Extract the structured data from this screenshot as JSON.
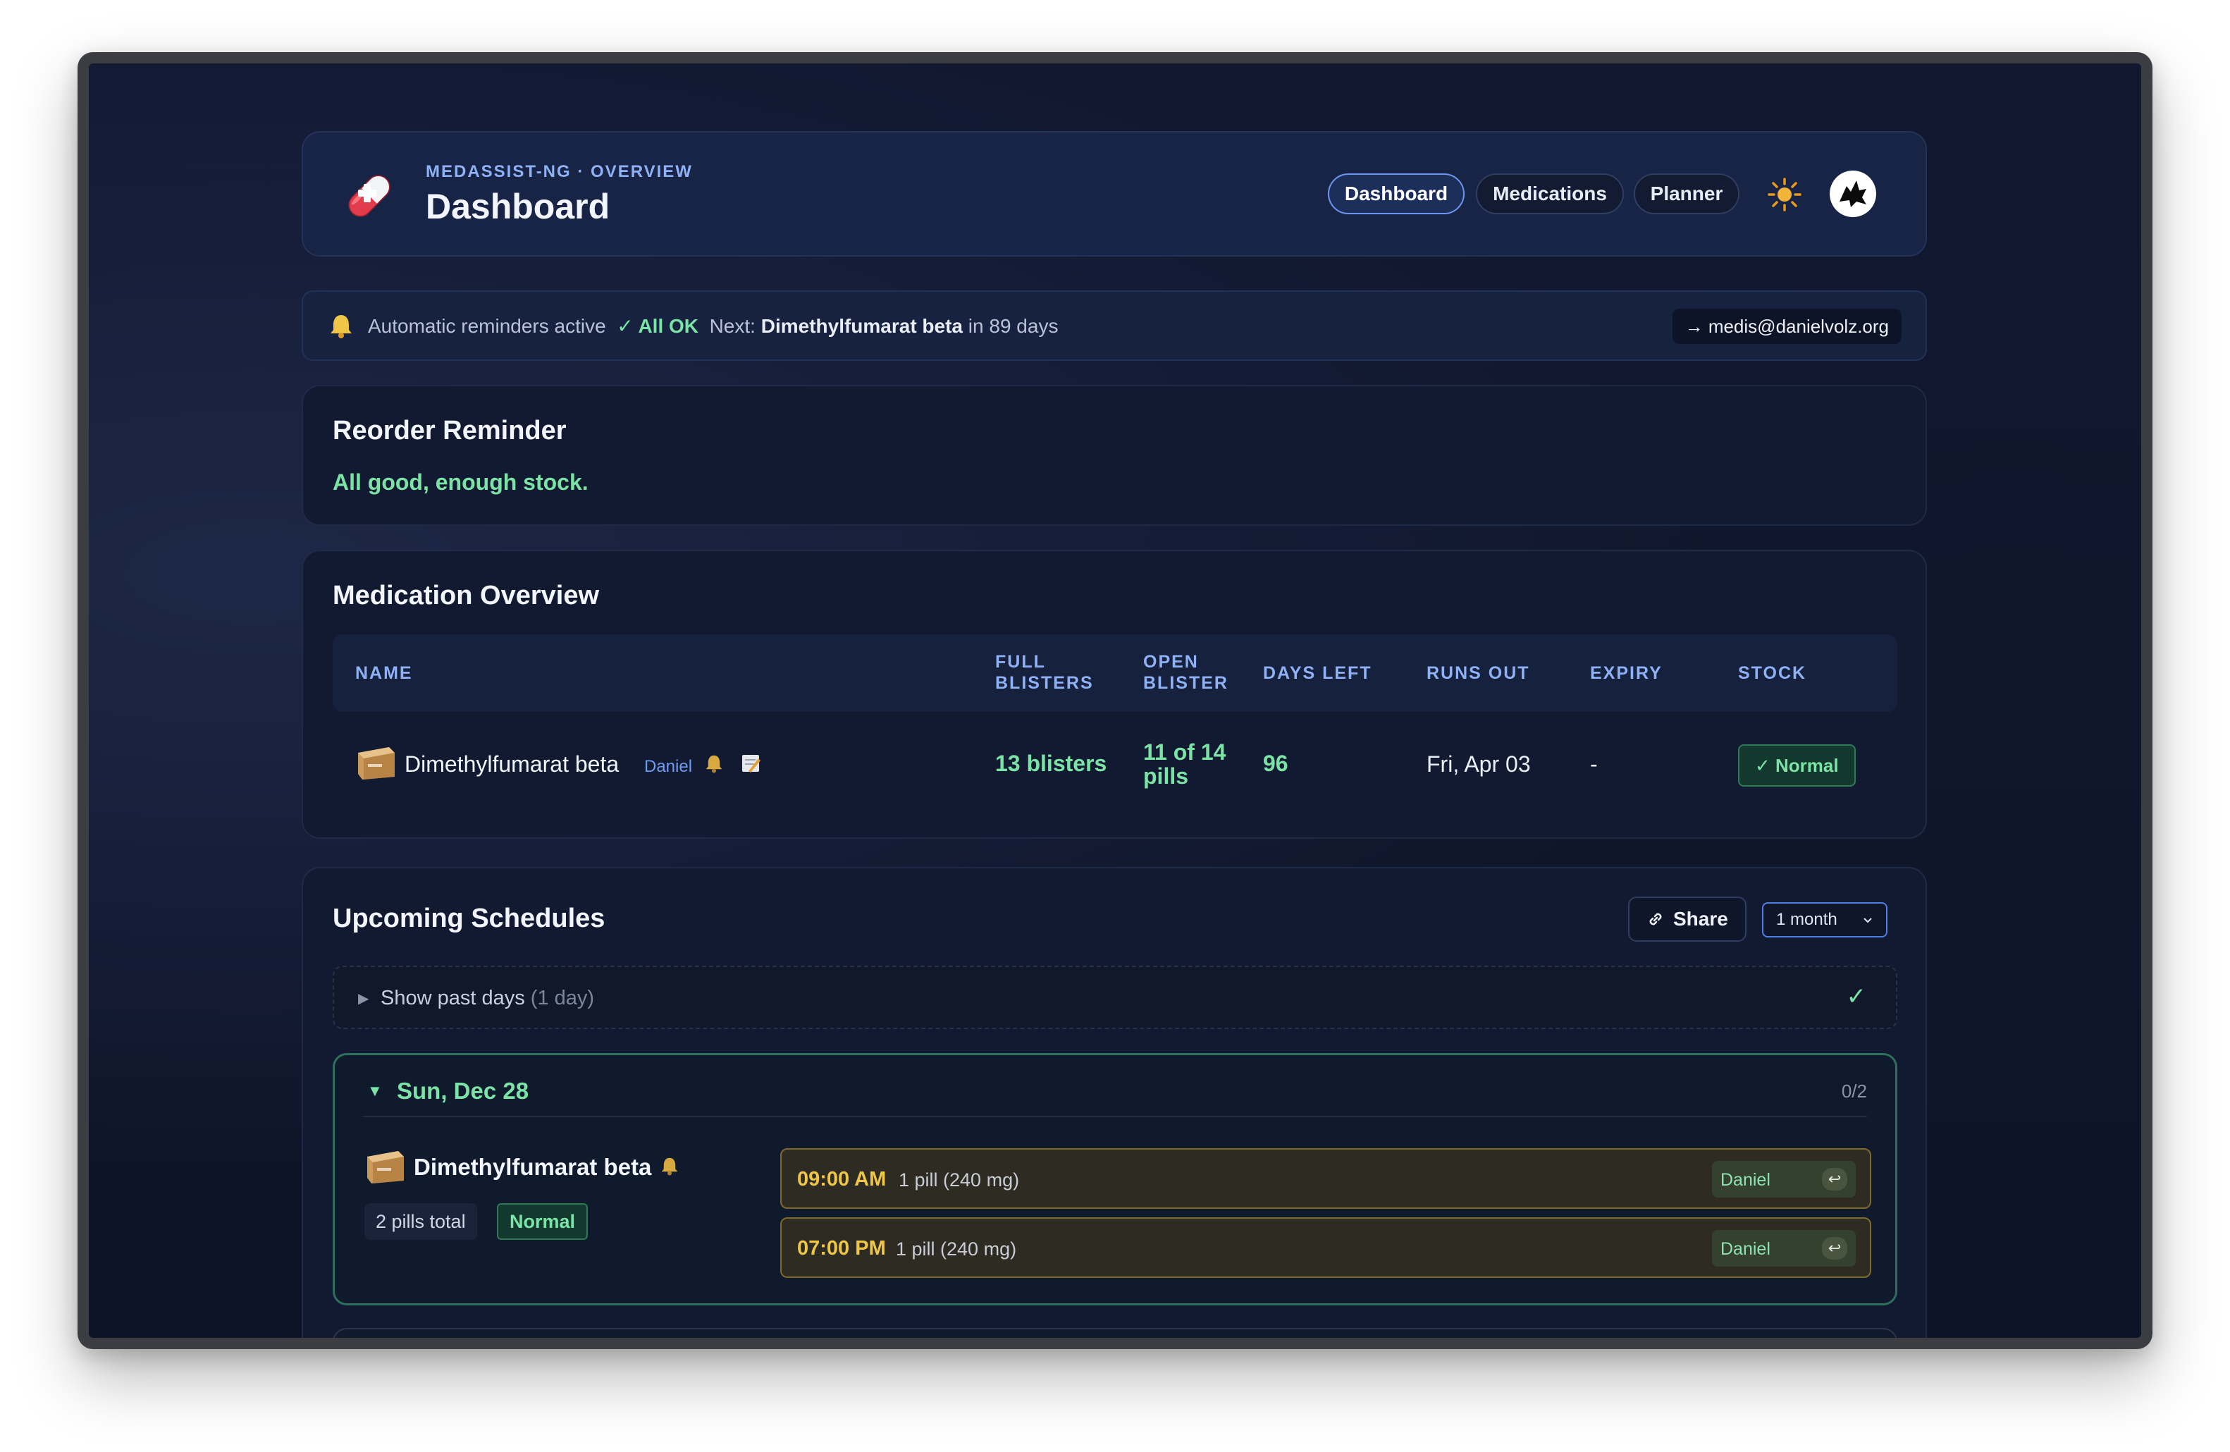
{
  "header": {
    "eyebrow": "MEDASSIST-NG · OVERVIEW",
    "title": "Dashboard",
    "nav": [
      "Dashboard",
      "Medications",
      "Planner"
    ],
    "active_nav": "Dashboard",
    "icons": {
      "logo": "pill-icon",
      "theme": "sun-icon",
      "avatar": "avatar-icon"
    }
  },
  "status": {
    "reminders_label": "Automatic reminders active",
    "ok_label": "✓ All OK",
    "next_prefix": "Next:",
    "next_med": "Dimethylfumarat beta",
    "next_suffix": "in 89 days",
    "email": "→ medis@danielvolz.org"
  },
  "reorder": {
    "title": "Reorder Reminder",
    "message": "All good, enough stock."
  },
  "overview": {
    "title": "Medication Overview",
    "columns": {
      "name": "NAME",
      "full_1": "FULL",
      "full_2": "BLISTERS",
      "open_1": "OPEN",
      "open_2": "BLISTER",
      "days_left": "DAYS LEFT",
      "runs_out": "RUNS OUT",
      "expiry": "EXPIRY",
      "stock": "STOCK"
    },
    "rows": [
      {
        "name": "Dimethylfumarat beta",
        "owner": "Daniel",
        "full_blisters": "13 blisters",
        "open_1": "11 of 14",
        "open_2": "pills",
        "days_left": "96",
        "runs_out": "Fri, Apr 03",
        "expiry": "-",
        "stock": "✓ Normal"
      }
    ]
  },
  "schedules": {
    "title": "Upcoming Schedules",
    "share_label": "Share",
    "range_value": "1 month",
    "past": {
      "label": "Show past days",
      "count": "(1 day)"
    },
    "days": [
      {
        "date": "Sun, Dec 28",
        "progress": "0/2",
        "medication": "Dimethylfumarat beta",
        "pills_total": "2 pills total",
        "stock": "Normal",
        "slots": [
          {
            "time": "09:00 AM",
            "dose": "1 pill (240 mg)",
            "who": "Daniel"
          },
          {
            "time": "07:00 PM",
            "dose": "1 pill (240 mg)",
            "who": "Daniel"
          }
        ]
      }
    ]
  },
  "colors": {
    "accent_blue": "#6d96f0",
    "ok_green": "#7be3a6",
    "time_yellow": "#f0c646",
    "background": "#0e1427"
  }
}
